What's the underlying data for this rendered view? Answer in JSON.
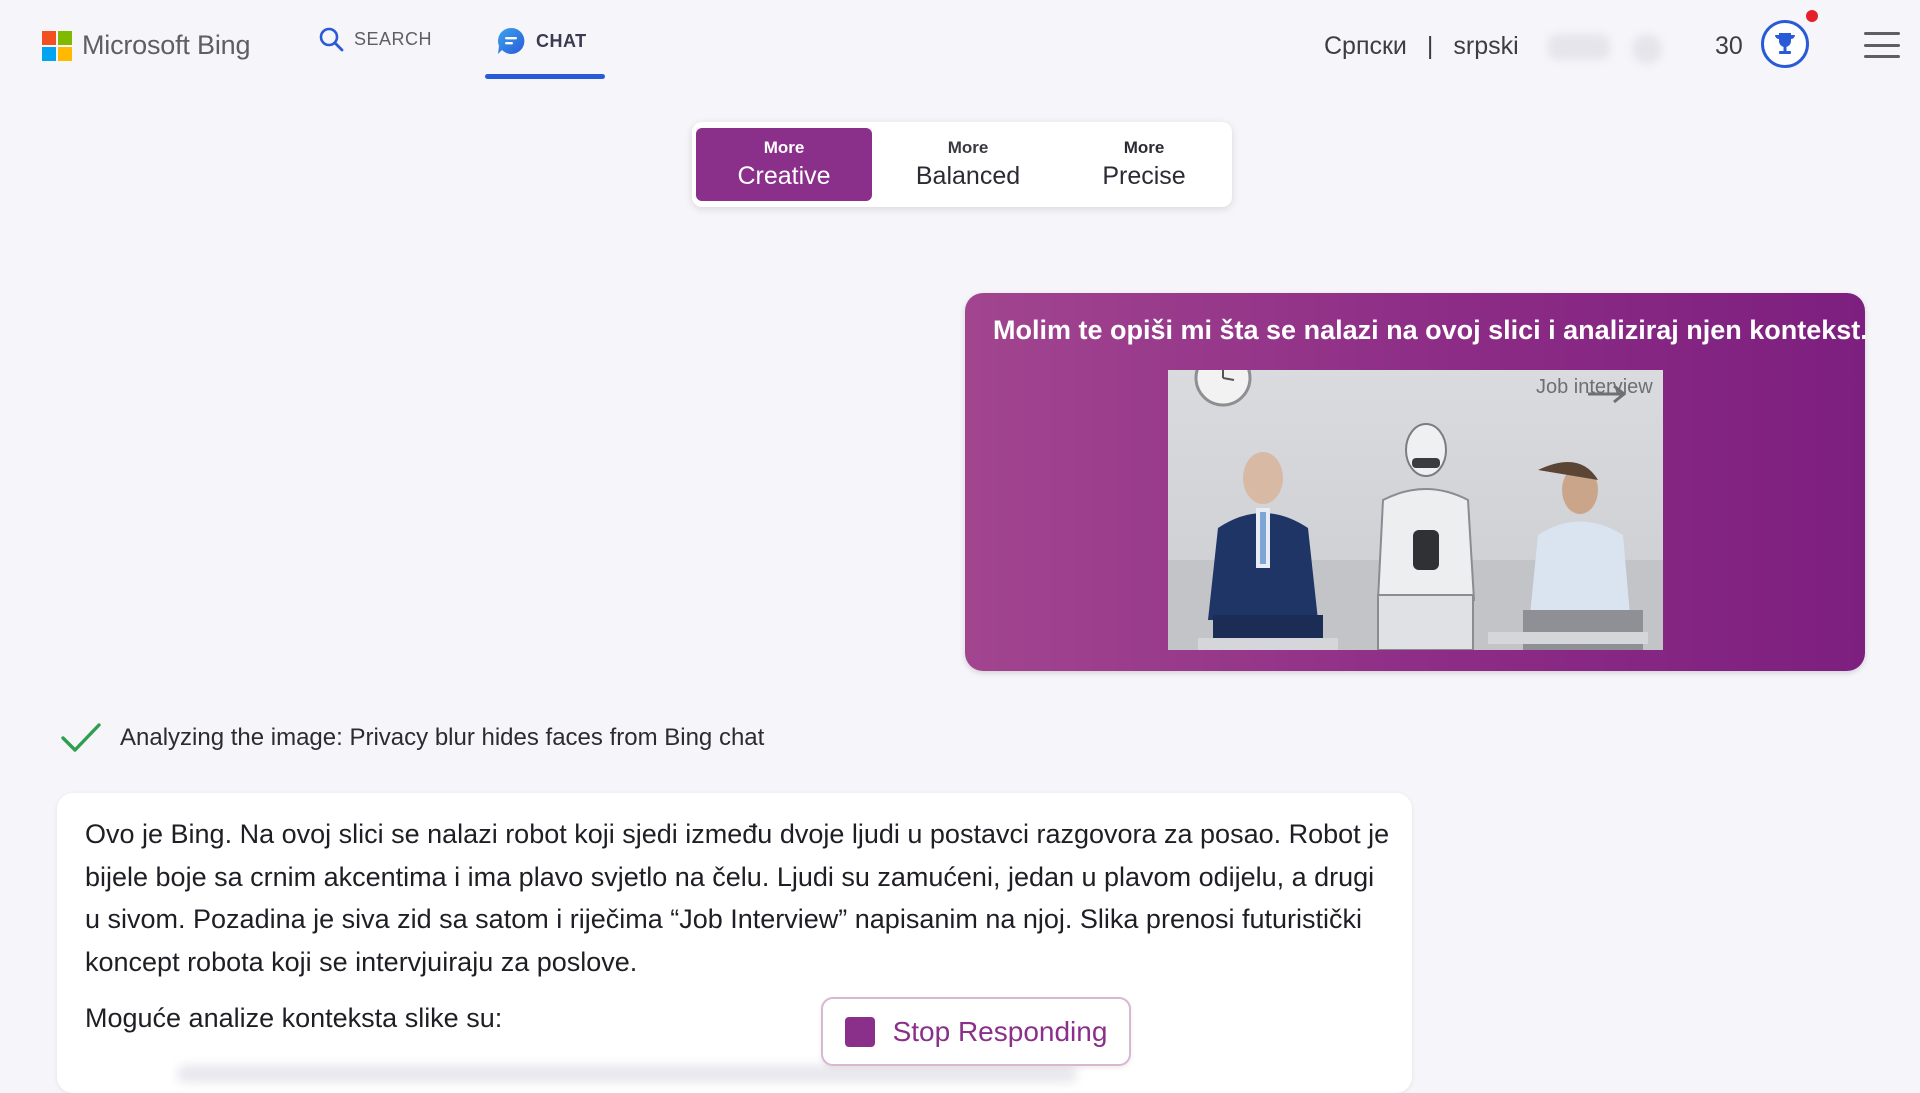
{
  "header": {
    "brand": "Microsoft Bing",
    "search_label": "SEARCH",
    "chat_label": "CHAT",
    "language_cyrillic": "Српски",
    "language_separator": "|",
    "language_latin": "srpski",
    "points": "30"
  },
  "tone_selector": {
    "options": [
      {
        "small": "More",
        "big": "Creative",
        "selected": true
      },
      {
        "small": "More",
        "big": "Balanced",
        "selected": false
      },
      {
        "small": "More",
        "big": "Precise",
        "selected": false
      }
    ]
  },
  "user_message": {
    "text": "Molim te opiši mi šta se nalazi na ovoj slici i analiziraj njen kontekst.",
    "image_caption": "Job interview"
  },
  "status": {
    "text": "Analyzing the image: Privacy blur hides faces from Bing chat"
  },
  "bot_response": {
    "paragraph": "Ovo je Bing. Na ovoj slici se nalazi robot koji sjedi između dvoje ljudi u postavci razgovora za posao. Robot je bijele boje sa crnim akcentima i ima plavo svjetlo na čelu. Ljudi su zamućeni, jedan u plavom odijelu, a drugi u sivom. Pozadina je siva zid sa satom i riječima “Job Interview” napisanim na njoj. Slika prenosi futuristički koncept robota koji se intervjuiraju za poslove.",
    "subheading": "Moguće analize konteksta slike su:"
  },
  "stop_button": {
    "label": "Stop Responding"
  },
  "colors": {
    "accent": "#8a2f8a",
    "tab_underline": "#2a5bd7",
    "user_bubble": "#8c2c86",
    "check": "#2e9e4f"
  }
}
